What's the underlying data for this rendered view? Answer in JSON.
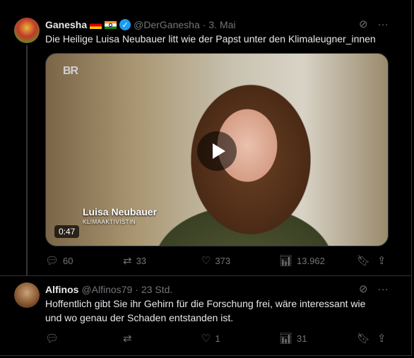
{
  "tweets": [
    {
      "name": "Ganesha",
      "handle": "@DerGanesha",
      "dot": "·",
      "date": "3. Mai",
      "text": "Die Heilige Luisa Neubauer litt wie der Papst unter den Klimaleugner_innen",
      "video": {
        "logo": "BR",
        "caption_name": "Luisa Neubauer",
        "caption_role": "KLIMAAKTIVISTIN",
        "duration": "0:47"
      },
      "stats": {
        "replies": "60",
        "reposts": "33",
        "likes": "373",
        "views": "13.962"
      },
      "icons": [
        "grok-icon",
        "more-icon",
        "reply-icon",
        "repost-icon",
        "like-icon",
        "views-icon",
        "bookmark-icon",
        "share-icon"
      ],
      "flags": [
        "flag-germany",
        "flag-india"
      ]
    },
    {
      "name": "Alfinos",
      "handle": "@Alfinos79",
      "dot": "·",
      "date": "23 Std.",
      "text_line1": "Hoffentlich gibt Sie ihr Gehirn für die Forschung frei, wäre interessant wie",
      "text_line2": "und wo genau der Schaden entstanden ist.",
      "stats": {
        "replies": "",
        "reposts": "",
        "likes": "1",
        "views": "31"
      }
    }
  ],
  "colors": {
    "background": "#000000",
    "text": "#e7e9ea",
    "muted": "#71767b",
    "verified": "#1d9bf0",
    "border": "#2f3336"
  }
}
